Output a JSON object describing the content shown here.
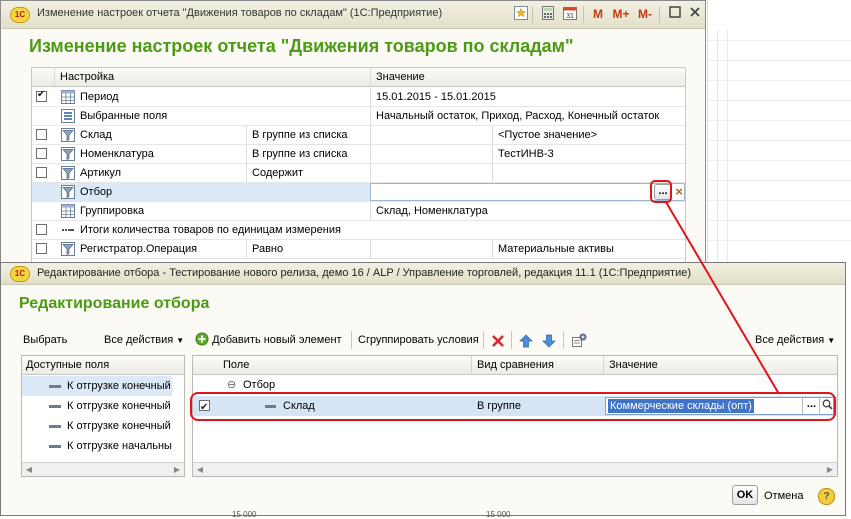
{
  "main_window": {
    "title": "Изменение настроек отчета \"Движения товаров по складам\"  (1С:Предприятие)",
    "heading": "Изменение настроек отчета \"Движения товаров по складам\"",
    "toolbar": {
      "m": "M",
      "m_plus": "M+",
      "m_minus": "M-",
      "calendar_day": "31"
    },
    "table": {
      "col_setting": "Настройка",
      "col_value": "Значение",
      "rows": [
        {
          "checked": true,
          "name": "Период",
          "cond": "",
          "value": "15.01.2015 - 15.01.2015",
          "value2": ""
        },
        {
          "checked": null,
          "name": "Выбранные поля",
          "cond": "",
          "value": "Начальный остаток, Приход, Расход, Конечный остаток",
          "value2": ""
        },
        {
          "checked": false,
          "name": "Склад",
          "cond": "В группе из списка",
          "value": "",
          "value2": "<Пустое значение>"
        },
        {
          "checked": false,
          "name": "Номенклатура",
          "cond": "В группе из списка",
          "value": "",
          "value2": "ТестИНВ-3"
        },
        {
          "checked": false,
          "name": "Артикул",
          "cond": "Содержит",
          "value": "",
          "value2": ""
        },
        {
          "checked": null,
          "name": "Отбор",
          "cond": "",
          "value": "",
          "value2": ""
        },
        {
          "checked": null,
          "name": "Группировка",
          "cond": "",
          "value": "Склад, Номенклатура",
          "value2": ""
        },
        {
          "checked": false,
          "name": "Итоги количества товаров по единицам измерения",
          "cond": "",
          "value": "",
          "value2": ""
        },
        {
          "checked": false,
          "name": "Регистратор.Операция",
          "cond": "Равно",
          "value": "",
          "value2": "Материальные активы"
        }
      ],
      "ellipsis_label": "...",
      "clear_label": "×"
    }
  },
  "filter_window": {
    "title": "Редактирование отбора - Тестирование нового релиза, демо 16 / ALP / Управление торговлей, редакция 11.1  (1С:Предприятие)",
    "heading": "Редактирование отбора",
    "commands": {
      "select": "Выбрать",
      "all_actions_left": "Все действия",
      "add_new": "Добавить новый элемент",
      "group_conditions": "Сгруппировать условия",
      "all_actions_right": "Все действия"
    },
    "available_fields": {
      "header": "Доступные поля",
      "items": [
        "К отгрузке конечный",
        "К отгрузке конечный",
        "К отгрузке конечный",
        "К отгрузке начальный"
      ]
    },
    "conditions": {
      "col_field": "Поле",
      "col_compare": "Вид сравнения",
      "col_value": "Значение",
      "group_label": "Отбор",
      "row": {
        "checked": true,
        "field": "Склад",
        "compare": "В группе",
        "value": "Коммерческие склады (опт)"
      },
      "ellipsis_label": "..."
    },
    "ok_label": "OK",
    "cancel_label": "Отмена",
    "help_label": "?"
  },
  "background_fragments": {
    "bottom_left": "15 000",
    "bottom_mid": "15 000"
  },
  "colors": {
    "heading_green": "#4c9a16",
    "highlight_red": "#e0141e",
    "selection_blue": "#3f74c9"
  }
}
